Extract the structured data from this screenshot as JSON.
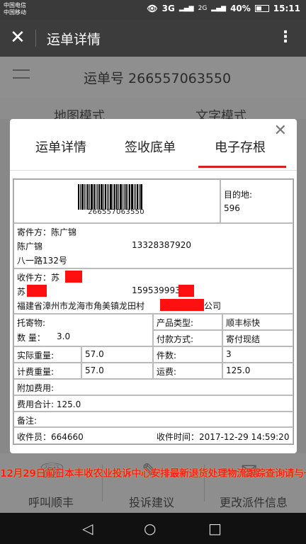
{
  "status_bar": {
    "carrier1": "中国电信",
    "carrier2": "中国移动",
    "net1": "3G",
    "net2": "2G",
    "battery": "40%",
    "time": "15:11"
  },
  "title_bar": {
    "title": "运单详情"
  },
  "background_page": {
    "waybill_no": "运单号 266557063550",
    "tabs": [
      "地图模式",
      "文字模式"
    ],
    "actions": [
      "呼叫顺丰",
      "投诉建议",
      "更改派件信息"
    ],
    "red_overlay_text": "12月29日前日本丰收农业投诉中心安排最新退货处理物流跟踪查询请与一七日内联系中国客服退款快速处理"
  },
  "modal": {
    "tabs": [
      "运单详情",
      "签收底单",
      "电子存根"
    ],
    "active_tab": "电子存根",
    "receipt": {
      "barcode_number": "266557063550",
      "destination_label": "目的地:",
      "destination_code": "596",
      "sender_label": "寄件方：陈广锦",
      "sender_name": "陈广锦",
      "sender_phone": "13328387920",
      "sender_address": "八一路132号",
      "receiver_label": "收件方：苏",
      "receiver_name": "苏",
      "receiver_phone": "159539993",
      "receiver_address_prefix": "福建省漳州市龙海市角美镇龙田村",
      "receiver_address_suffix": "公司",
      "goods_label": "托寄物:",
      "quantity_label": "数 量：",
      "quantity_value": "3.0",
      "product_type_label": "产品类型:",
      "product_type_value": "顺丰标快",
      "payment_label": "付款方式:",
      "payment_value": "寄付现结",
      "actual_weight_label": "实际重量:",
      "actual_weight_value": "57.0",
      "pieces_label": "件数:",
      "pieces_value": "3",
      "billing_weight_label": "计费重量:",
      "billing_weight_value": "57.0",
      "freight_label": "运费:",
      "freight_value": "125.0",
      "extra_fee_label": "附加费用:",
      "total_fee_label": "费用合计: 125.0",
      "remarks_label": "备注:",
      "courier_label": "收件员：664660",
      "pickup_time_label": "收件时间：2017-12-29 14:59:20"
    }
  },
  "nav_bar": {
    "back": "◁",
    "home": "○",
    "recent": "□"
  }
}
